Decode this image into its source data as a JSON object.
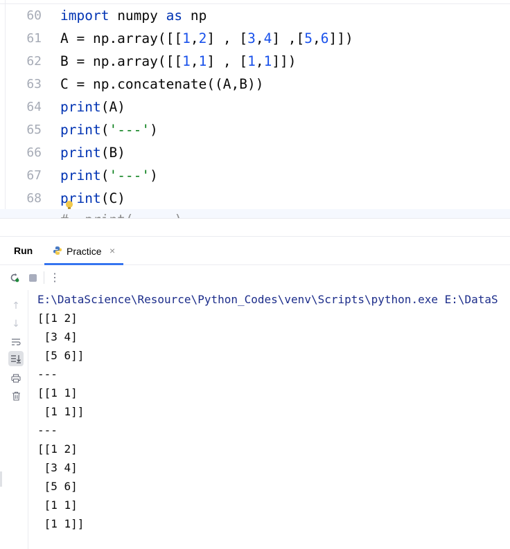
{
  "editor": {
    "lines": [
      {
        "num": "60",
        "tokens": [
          {
            "t": "import",
            "c": "kw"
          },
          {
            "t": " numpy ",
            "c": ""
          },
          {
            "t": "as",
            "c": "kw"
          },
          {
            "t": " np",
            "c": ""
          }
        ]
      },
      {
        "num": "61",
        "tokens": [
          {
            "t": "A = np.array([[",
            "c": ""
          },
          {
            "t": "1",
            "c": "num"
          },
          {
            "t": ",",
            "c": ""
          },
          {
            "t": "2",
            "c": "num"
          },
          {
            "t": "] , [",
            "c": ""
          },
          {
            "t": "3",
            "c": "num"
          },
          {
            "t": ",",
            "c": ""
          },
          {
            "t": "4",
            "c": "num"
          },
          {
            "t": "] ,[",
            "c": ""
          },
          {
            "t": "5",
            "c": "num"
          },
          {
            "t": ",",
            "c": ""
          },
          {
            "t": "6",
            "c": "num"
          },
          {
            "t": "]])",
            "c": ""
          }
        ]
      },
      {
        "num": "62",
        "tokens": [
          {
            "t": "B = np.array([[",
            "c": ""
          },
          {
            "t": "1",
            "c": "num"
          },
          {
            "t": ",",
            "c": ""
          },
          {
            "t": "1",
            "c": "num"
          },
          {
            "t": "] , [",
            "c": ""
          },
          {
            "t": "1",
            "c": "num"
          },
          {
            "t": ",",
            "c": ""
          },
          {
            "t": "1",
            "c": "num"
          },
          {
            "t": "]])",
            "c": ""
          }
        ]
      },
      {
        "num": "63",
        "tokens": [
          {
            "t": "C = np.concatenate((A,B))",
            "c": ""
          }
        ]
      },
      {
        "num": "64",
        "tokens": [
          {
            "t": "print",
            "c": "kw"
          },
          {
            "t": "(A)",
            "c": ""
          }
        ]
      },
      {
        "num": "65",
        "tokens": [
          {
            "t": "print",
            "c": "kw"
          },
          {
            "t": "(",
            "c": ""
          },
          {
            "t": "'---'",
            "c": "str"
          },
          {
            "t": ")",
            "c": ""
          }
        ]
      },
      {
        "num": "66",
        "tokens": [
          {
            "t": "print",
            "c": "kw"
          },
          {
            "t": "(B)",
            "c": ""
          }
        ]
      },
      {
        "num": "67",
        "tokens": [
          {
            "t": "print",
            "c": "kw"
          },
          {
            "t": "(",
            "c": ""
          },
          {
            "t": "'---'",
            "c": "str"
          },
          {
            "t": ")",
            "c": ""
          }
        ]
      },
      {
        "num": "68",
        "tokens": [
          {
            "t": "print",
            "c": "kw"
          },
          {
            "t": "(C)",
            "c": ""
          }
        ]
      }
    ],
    "partial_line": "#  print( ... )"
  },
  "run_panel": {
    "title": "Run",
    "tab_label": "Practice",
    "tab_close": "×",
    "rerun_icon": "rerun-icon",
    "stop_icon": "stop-icon",
    "more_icon": "more-options-icon",
    "side_icons": [
      "arrow-up-icon",
      "arrow-down-icon",
      "soft-wrap-icon",
      "scroll-to-end-icon",
      "print-icon",
      "trash-icon"
    ],
    "console_lines": [
      "E:\\DataScience\\Resource\\Python_Codes\\venv\\Scripts\\python.exe E:\\DataS",
      "[[1 2]",
      " [3 4]",
      " [5 6]]",
      "---",
      "[[1 1]",
      " [1 1]]",
      "---",
      "[[1 2]",
      " [3 4]",
      " [5 6]",
      " [1 1]",
      " [1 1]]"
    ]
  },
  "colors": {
    "keyword": "#0033b3",
    "number": "#1750eb",
    "string": "#067d17",
    "accent": "#3574f0"
  }
}
